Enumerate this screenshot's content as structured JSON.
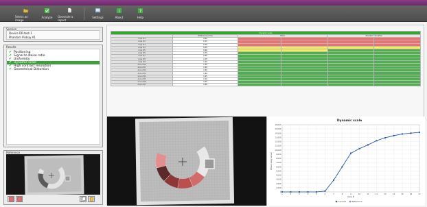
{
  "toolbar": {
    "items": [
      {
        "label": "Select an image",
        "icon": "folder-icon"
      },
      {
        "label": "Analyze",
        "icon": "analyze-icon"
      },
      {
        "label": "Generate a report",
        "icon": "report-icon"
      },
      {
        "label": "Settings",
        "icon": "settings-icon"
      },
      {
        "label": "About",
        "icon": "info-icon"
      },
      {
        "label": "Help",
        "icon": "help-icon"
      }
    ]
  },
  "session": {
    "title": "Session",
    "device_line": "Device   DR-test-1",
    "phantom_line": "Phantom Pixbuy A1"
  },
  "results": {
    "title": "Results",
    "items": [
      {
        "label": "Positioning",
        "selected": false
      },
      {
        "label": "Signal to Noise ratio",
        "selected": false
      },
      {
        "label": "Uniformity",
        "selected": false
      },
      {
        "label": "Dynamic scale",
        "selected": true
      },
      {
        "label": "High contrast resolution",
        "selected": false
      },
      {
        "label": "Geometrical Distortion",
        "selected": false
      }
    ]
  },
  "reference": {
    "title": "Reference"
  },
  "table": {
    "title": "Dynamic scale",
    "headers": [
      "",
      "Reference (mm)",
      "Mean",
      "",
      "Standard deviation",
      ""
    ],
    "rows": [
      {
        "label": "Area #1",
        "ref": "0.00",
        "c": [
          "r",
          "r",
          "r",
          "r"
        ]
      },
      {
        "label": "Area #2",
        "ref": "0.15",
        "c": [
          "r",
          "r",
          "r",
          "r"
        ]
      },
      {
        "label": "Area #3",
        "ref": "0.30",
        "c": [
          "r",
          "r",
          "r",
          "r"
        ]
      },
      {
        "label": "Area #4",
        "ref": "0.45",
        "c": [
          "y",
          "y",
          "y",
          "y"
        ]
      },
      {
        "label": "Area #5",
        "ref": "0.60",
        "c": [
          "y",
          "y",
          "g",
          "g"
        ]
      },
      {
        "label": "Area #6",
        "ref": "0.75",
        "c": [
          "g",
          "g",
          "g",
          "g"
        ]
      },
      {
        "label": "Area #7",
        "ref": "0.90",
        "c": [
          "g",
          "g",
          "g",
          "g"
        ]
      },
      {
        "label": "Area #8",
        "ref": "1.05",
        "c": [
          "g",
          "g",
          "g",
          "g"
        ]
      },
      {
        "label": "Area #9",
        "ref": "1.20",
        "c": [
          "g",
          "g",
          "g",
          "g"
        ]
      },
      {
        "label": "Area #10",
        "ref": "1.35",
        "c": [
          "g",
          "g",
          "g",
          "g"
        ]
      },
      {
        "label": "Area #11",
        "ref": "1.50",
        "c": [
          "g",
          "g",
          "g",
          "g"
        ]
      },
      {
        "label": "Area #12",
        "ref": "1.65",
        "c": [
          "g",
          "g",
          "g",
          "g"
        ]
      },
      {
        "label": "Area #13",
        "ref": "1.80",
        "c": [
          "g",
          "g",
          "g",
          "g"
        ]
      },
      {
        "label": "Area #14",
        "ref": "1.95",
        "c": [
          "g",
          "g",
          "g",
          "g"
        ]
      },
      {
        "label": "Area #15",
        "ref": "2.10",
        "c": [
          "g",
          "g",
          "g",
          "g"
        ]
      },
      {
        "label": "Area #16",
        "ref": "2.25",
        "c": [
          "g",
          "g",
          "g",
          "g"
        ]
      },
      {
        "label": "Area #17",
        "ref": "2.40",
        "c": [
          "g",
          "g",
          "g",
          "g"
        ]
      }
    ],
    "colors": {
      "r": "#f07070",
      "y": "#f2ef5a",
      "g": "#4cb04c"
    }
  },
  "chart_data": {
    "type": "line",
    "title": "Dynamic scale",
    "xlabel": "Area #",
    "ylabel": "Mean Grey Level",
    "x": [
      1,
      2,
      3,
      4,
      5,
      6,
      7,
      8,
      9,
      10,
      11,
      12,
      13,
      14,
      15,
      16,
      17
    ],
    "xlim": [
      1,
      17
    ],
    "ylim": [
      0,
      16000
    ],
    "yticks": [
      "0",
      "1,000",
      "2,000",
      "3,000",
      "4,000",
      "5,000",
      "6,000",
      "7,000",
      "8,000",
      "9,000",
      "10,000",
      "11,000",
      "12,000",
      "13,000",
      "14,000",
      "15,000",
      "16,000"
    ],
    "grid": true,
    "legend_position": "bottom",
    "series": [
      {
        "name": "Current",
        "color": "#2a5ca8",
        "values": [
          0,
          0,
          0,
          0,
          0,
          200,
          2800,
          6000,
          9200,
          10300,
          11200,
          12200,
          12900,
          13400,
          13800,
          14000,
          14200
        ]
      },
      {
        "name": "Reference",
        "color": "#7a8ec0",
        "values": [
          0,
          0,
          0,
          0,
          0,
          200,
          2800,
          6000,
          9200,
          10300,
          11200,
          12200,
          12900,
          13400,
          13800,
          14000,
          14200
        ]
      }
    ]
  }
}
